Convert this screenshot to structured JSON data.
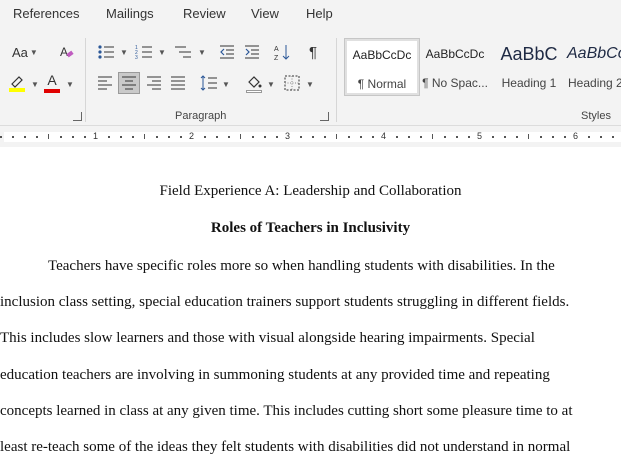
{
  "menu": {
    "tabs": [
      "References",
      "Mailings",
      "Review",
      "View",
      "Help"
    ]
  },
  "ribbon": {
    "font_group": {
      "case_label": "Aa",
      "highlight_color": "#ffff00",
      "font_color_letter": "A",
      "font_color": "#e00000"
    },
    "paragraph_group_label": "Paragraph",
    "styles_group_label": "Styles",
    "styles": [
      {
        "preview": "AaBbCcDc",
        "label": "¶ Normal"
      },
      {
        "preview": "AaBbCcDc",
        "label": "¶ No Spac..."
      },
      {
        "preview": "AaBbC",
        "label": "Heading 1"
      },
      {
        "preview": "AaBbCc",
        "label": "Heading 2"
      }
    ]
  },
  "ruler": {
    "numbers": [
      "1",
      "2",
      "3",
      "4",
      "5",
      "6"
    ]
  },
  "document": {
    "title": "Field Experience A: Leadership and Collaboration",
    "heading": "Roles of Teachers in Inclusivity",
    "lines": [
      "Teachers have specific roles more so when handling students with disabilities. In the",
      "inclusion class setting, special education trainers support students struggling in different fields.",
      "This includes slow learners and those with visual alongside hearing impairments. Special",
      "education teachers are involving in summoning students at any provided time and repeating",
      "concepts learned in class at any given time. This includes cutting short some pleasure time to at",
      "least re-teach some of the ideas they felt students with disabilities did not understand in normal"
    ]
  }
}
